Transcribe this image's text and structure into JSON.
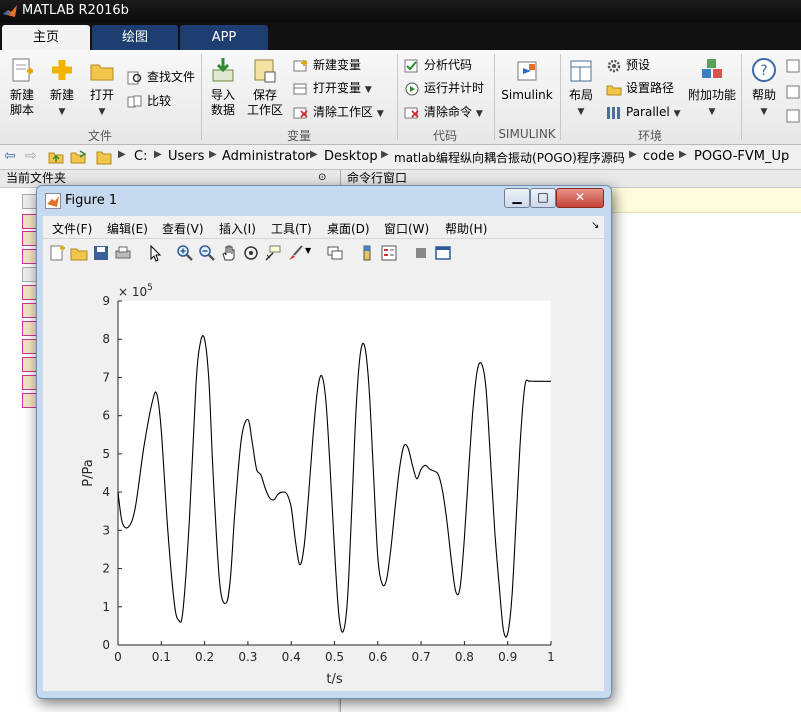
{
  "window": {
    "title": "MATLAB R2016b"
  },
  "tabs": [
    {
      "label": "主页",
      "active": true
    },
    {
      "label": "绘图",
      "active": false
    },
    {
      "label": "APP",
      "active": false
    }
  ],
  "ribbon": {
    "file": {
      "group_label": "文件",
      "new_script": {
        "line1": "新建",
        "line2": "脚本"
      },
      "new": "新建",
      "open": "打开",
      "find_files": "查找文件",
      "compare": "比较"
    },
    "variable": {
      "group_label": "变量",
      "import": {
        "line1": "导入",
        "line2": "数据"
      },
      "save_workspace": {
        "line1": "保存",
        "line2": "工作区"
      },
      "new_variable": "新建变量",
      "open_variable": "打开变量",
      "clear_workspace": "清除工作区"
    },
    "code": {
      "group_label": "代码",
      "analyze_code": "分析代码",
      "run_and_time": "运行并计时",
      "clear_commands": "清除命令"
    },
    "simulink": {
      "group_label": "SIMULINK",
      "simulink": "Simulink"
    },
    "environment": {
      "group_label": "环境",
      "layout": "布局",
      "preferences": "预设",
      "set_path": "设置路径",
      "parallel": "Parallel",
      "addons": "附加功能"
    },
    "resources": {
      "help": "帮助"
    }
  },
  "address": {
    "crumbs": [
      "C:",
      "Users",
      "Administrator",
      "Desktop",
      "matlab编程纵向耦合振动(POGO)程序源码",
      "code",
      "POGO-FVM_Up"
    ]
  },
  "panels": {
    "current_folder": "当前文件夹",
    "command_window": "命令行窗口"
  },
  "figure": {
    "title": "Figure 1",
    "menus": [
      "文件(F)",
      "编辑(E)",
      "查看(V)",
      "插入(I)",
      "工具(T)",
      "桌面(D)",
      "窗口(W)",
      "帮助(H)"
    ]
  },
  "chart_data": {
    "type": "line",
    "xlabel": "t/s",
    "ylabel": "P/Pa",
    "exponent_label": "× 10",
    "exponent_power": "5",
    "xlim": [
      0,
      1
    ],
    "ylim": [
      0,
      9
    ],
    "xticks": [
      "0",
      "0.1",
      "0.2",
      "0.3",
      "0.4",
      "0.5",
      "0.6",
      "0.7",
      "0.8",
      "0.9",
      "1"
    ],
    "yticks": [
      "0",
      "1",
      "2",
      "3",
      "4",
      "5",
      "6",
      "7",
      "8",
      "9"
    ],
    "y_scale_factor": 100000,
    "series": [
      {
        "color": "#000000",
        "x": [
          0,
          0.01,
          0.025,
          0.04,
          0.06,
          0.08,
          0.09,
          0.1,
          0.115,
          0.13,
          0.14,
          0.15,
          0.165,
          0.18,
          0.19,
          0.2,
          0.21,
          0.22,
          0.235,
          0.25,
          0.26,
          0.27,
          0.285,
          0.3,
          0.31,
          0.32,
          0.33,
          0.34,
          0.35,
          0.36,
          0.37,
          0.38,
          0.39,
          0.4,
          0.41,
          0.42,
          0.43,
          0.44,
          0.45,
          0.46,
          0.47,
          0.48,
          0.49,
          0.5,
          0.51,
          0.52,
          0.53,
          0.54,
          0.55,
          0.56,
          0.57,
          0.58,
          0.59,
          0.6,
          0.61,
          0.62,
          0.63,
          0.64,
          0.65,
          0.66,
          0.67,
          0.68,
          0.69,
          0.7,
          0.71,
          0.72,
          0.73,
          0.74,
          0.75,
          0.76,
          0.77,
          0.78,
          0.79,
          0.8,
          0.81,
          0.82,
          0.83,
          0.84,
          0.85,
          0.86,
          0.87,
          0.88,
          0.89,
          0.9,
          0.91,
          0.92,
          0.93,
          0.94,
          0.95,
          0.96,
          0.97,
          0.98,
          0.99,
          1.0
        ],
        "y": [
          4.0,
          3.2,
          3.1,
          3.6,
          5.2,
          6.4,
          6.55,
          5.6,
          3.0,
          1.1,
          0.65,
          0.9,
          3.3,
          6.8,
          7.9,
          8.0,
          6.9,
          4.4,
          1.6,
          1.1,
          1.8,
          3.5,
          5.4,
          5.9,
          5.3,
          4.6,
          4.45,
          4.1,
          3.85,
          3.8,
          3.95,
          4.0,
          3.95,
          3.6,
          2.7,
          2.1,
          2.6,
          3.9,
          5.4,
          6.6,
          7.05,
          6.4,
          4.6,
          2.5,
          0.8,
          0.35,
          1.2,
          3.6,
          6.2,
          7.65,
          7.8,
          6.7,
          4.5,
          2.3,
          1.6,
          1.7,
          2.5,
          3.6,
          4.6,
          5.2,
          5.15,
          4.7,
          4.35,
          4.6,
          4.7,
          4.6,
          4.55,
          4.45,
          4.0,
          3.2,
          2.2,
          1.4,
          1.5,
          2.8,
          4.6,
          6.2,
          7.2,
          7.35,
          6.7,
          4.9,
          3.0,
          1.6,
          0.4,
          0.3,
          1.3,
          3.4,
          5.5,
          6.8,
          6.9,
          6.9,
          6.9,
          6.9,
          6.9,
          6.9
        ]
      }
    ]
  }
}
